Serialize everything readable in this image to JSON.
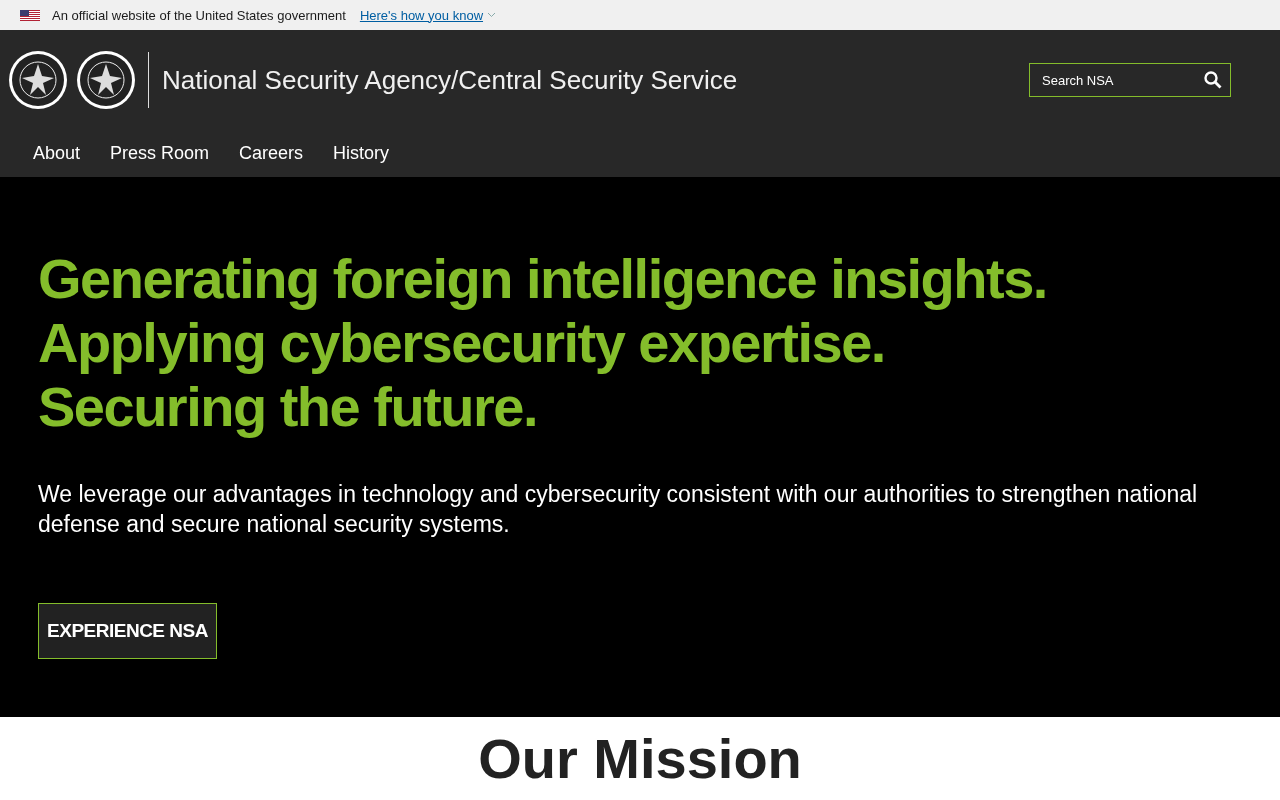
{
  "gov_banner": {
    "text": "An official website of the United States government",
    "link": "Here's how you know"
  },
  "header": {
    "title": "National Security Agency/Central Security Service",
    "search": {
      "placeholder": "Search NSA"
    }
  },
  "nav": [
    {
      "label": "About"
    },
    {
      "label": "Press Room"
    },
    {
      "label": "Careers"
    },
    {
      "label": "History"
    }
  ],
  "hero": {
    "headline": [
      "Generating foreign intelligence insights.",
      "Applying cybersecurity expertise.",
      "Securing the future."
    ],
    "body": "We leverage our advantages in technology and cybersecurity consistent with our authorities to strengthen national defense and secure national security systems.",
    "button": "EXPERIENCE NSA"
  },
  "mission": {
    "heading": "Our Mission"
  }
}
